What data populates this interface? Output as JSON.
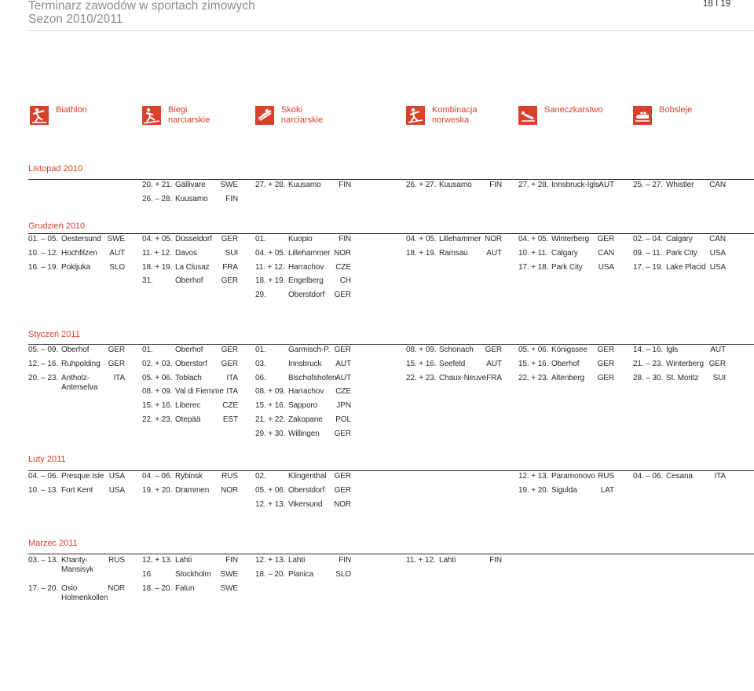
{
  "header": {
    "title_line1": "Terminarz zawodów w sportach zimowych",
    "title_line2": "Sezon 2010/2011",
    "page": "18 I 19"
  },
  "sports": [
    {
      "icon": "biathlon-icon",
      "label": [
        "Biathlon"
      ]
    },
    {
      "icon": "cross-country-skiing-icon",
      "label": [
        "Biegi",
        "narciarskie"
      ]
    },
    {
      "icon": "ski-jumping-icon",
      "label": [
        "Skoki",
        "narciarskie"
      ]
    },
    {
      "icon": "nordic-combined-icon",
      "label": [
        "Kombinacja",
        "norweska"
      ]
    },
    {
      "icon": "luge-icon",
      "label": [
        "Saneczkarstwo"
      ]
    },
    {
      "icon": "bobsleigh-icon",
      "label": [
        "Bobsleje"
      ]
    }
  ],
  "accent_color": "#d9412b",
  "months": [
    {
      "name": "Listopad 2010",
      "columns": [
        [],
        [
          [
            "20. + 21.",
            "Gällivare",
            "SWE"
          ],
          [
            "26. – 28.",
            "Kuusamo",
            "FIN"
          ]
        ],
        [
          [
            "27. + 28.",
            "Kuusamo",
            "FIN"
          ]
        ],
        [
          [
            "26. + 27.",
            "Kuusamo",
            "FIN"
          ]
        ],
        [
          [
            "27. + 28.",
            "Innsbruck-Igls",
            "AUT"
          ]
        ],
        [
          [
            "25. – 27.",
            "Whistler",
            "CAN"
          ]
        ]
      ]
    },
    {
      "name": "Grudzień 2010",
      "columns": [
        [
          [
            "01. – 05.",
            "Oestersund",
            "SWE"
          ],
          [
            "10. – 12.",
            "Hochfilzen",
            "AUT"
          ],
          [
            "16. – 19.",
            "Pokljuka",
            "SLO"
          ]
        ],
        [
          [
            "04. + 05.",
            "Düsseldorf",
            "GER"
          ],
          [
            "11. + 12.",
            "Davos",
            "SUI"
          ],
          [
            "18. + 19.",
            "La Clusaz",
            "FRA"
          ],
          [
            "31.",
            "Oberhof",
            "GER"
          ]
        ],
        [
          [
            "01.",
            "Kuopio",
            "FIN"
          ],
          [
            "04. + 05.",
            "Lillehammer",
            "NOR"
          ],
          [
            "11. + 12.",
            "Harrachov",
            "CZE"
          ],
          [
            "18. + 19.",
            "Engelberg",
            "CH"
          ],
          [
            "29.",
            "Oberstdorf",
            "GER"
          ]
        ],
        [
          [
            "04. + 05.",
            "Lillehammer",
            "NOR"
          ],
          [
            "18. + 19.",
            "Ramsau",
            "AUT"
          ]
        ],
        [
          [
            "04. + 05.",
            "Winterberg",
            "GER"
          ],
          [
            "10. + 11.",
            "Calgary",
            "CAN"
          ],
          [
            "17. + 18.",
            "Park City",
            "USA"
          ]
        ],
        [
          [
            "02. – 04.",
            "Calgary",
            "CAN"
          ],
          [
            "09. – 11.",
            "Park City",
            "USA"
          ],
          [
            "17. – 19.",
            "Lake Placid",
            "USA"
          ]
        ]
      ]
    },
    {
      "name": "Styczeń 2011",
      "columns": [
        [
          [
            "05. – 09.",
            "Oberhof",
            "GER"
          ],
          [
            "12. – 16.",
            "Ruhpolding",
            "GER"
          ],
          [
            "20. – 23.",
            "Antholz-\nAnterselva",
            "ITA"
          ]
        ],
        [
          [
            "01.",
            "Oberhof",
            "GER"
          ],
          [
            "02. + 03.",
            "Oberstorf",
            "GER"
          ],
          [
            "05. + 06.",
            "Toblach",
            "ITA"
          ],
          [
            "08. + 09.",
            "Val di Fiemme",
            "ITA"
          ],
          [
            "15. + 16.",
            "Liberec",
            "CZE"
          ],
          [
            "22. + 23.",
            "Otepää",
            "EST"
          ]
        ],
        [
          [
            "01.",
            "Garmisch-P.",
            "GER"
          ],
          [
            "03.",
            "Innsbruck",
            "AUT"
          ],
          [
            "06.",
            "Bischofshofen",
            "AUT"
          ],
          [
            "08. + 09.",
            "Harrachov",
            "CZE"
          ],
          [
            "15. + 16.",
            "Sapporo",
            "JPN"
          ],
          [
            "21. + 22.",
            "Zakopane",
            "POL"
          ],
          [
            "29. + 30.",
            "Willingen",
            "GER"
          ]
        ],
        [
          [
            "08. + 09.",
            "Schonach",
            "GER"
          ],
          [
            "15. + 16.",
            "Seefeld",
            "AUT"
          ],
          [
            "22. + 23.",
            "Chaux-Neuve",
            "FRA"
          ]
        ],
        [
          [
            "05. + 06.",
            "Königssee",
            "GER"
          ],
          [
            "15. + 16.",
            "Oberhof",
            "GER"
          ],
          [
            "22. + 23.",
            "Altenberg",
            "GER"
          ]
        ],
        [
          [
            "14. – 16.",
            "Igls",
            "AUT"
          ],
          [
            "21. – 23.",
            "Winterberg",
            "GER"
          ],
          [
            "28. – 30.",
            "St. Moritz",
            "SUI"
          ]
        ]
      ]
    },
    {
      "name": "Luty 2011",
      "columns": [
        [
          [
            "04. – 06.",
            "Presque Isle",
            "USA"
          ],
          [
            "10. – 13.",
            "Fort Kent",
            "USA"
          ]
        ],
        [
          [
            "04. – 06.",
            "Rybinsk",
            "RUS"
          ],
          [
            "19. + 20.",
            "Drammen",
            "NOR"
          ]
        ],
        [
          [
            "02.",
            "Klingenthal",
            "GER"
          ],
          [
            "05. + 06.",
            "Oberstdorf",
            "GER"
          ],
          [
            "12. + 13.",
            "Vikersund",
            "NOR"
          ]
        ],
        [],
        [
          [
            "12. + 13.",
            "Paramonovo",
            "RUS"
          ],
          [
            "19. + 20.",
            "Sigulda",
            "LAT"
          ]
        ],
        [
          [
            "04. – 06.",
            "Cesana",
            "ITA"
          ]
        ]
      ]
    },
    {
      "name": "Marzec 2011",
      "columns": [
        [
          [
            "03. – 13.",
            "Khanty-\nMansisyk",
            "RUS"
          ],
          [
            "17. – 20.",
            "Oslo\nHolmenkollen",
            "NOR"
          ]
        ],
        [
          [
            "12. + 13.",
            "Lahti",
            "FIN"
          ],
          [
            "16.",
            "Stockholm",
            "SWE"
          ],
          [
            "18. – 20.",
            "Falun",
            "SWE"
          ]
        ],
        [
          [
            "12. + 13.",
            "Lahti",
            "FIN"
          ],
          [
            "18. – 20.",
            "Planica",
            "SLO"
          ]
        ],
        [
          [
            "11. + 12.",
            "Lahti",
            "FIN"
          ]
        ],
        [],
        []
      ]
    }
  ]
}
